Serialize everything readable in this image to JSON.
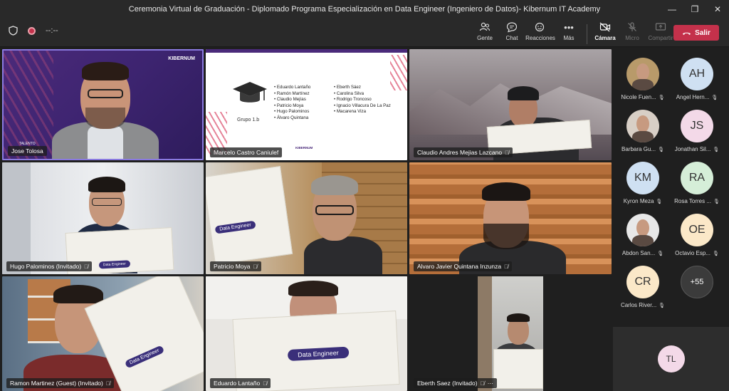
{
  "window": {
    "title": "Ceremonia Virtual de Graduación - Diplomado Programa Especialización en Data Engineer (Ingeniero de Datos)- Kibernum IT Academy",
    "minimize": "—",
    "maximize": "❐",
    "close": "✕"
  },
  "toolbar": {
    "timer": "--:--",
    "people_label": "Gente",
    "chat_label": "Chat",
    "reactions_label": "Reacciones",
    "more_label": "Más",
    "camera_label": "Cámara",
    "mic_label": "Micro",
    "share_label": "Compartir",
    "leave_label": "Salir"
  },
  "slide": {
    "brand": "KIBERNUM",
    "group": "Grupo 1.b",
    "col1": [
      "Eduardo Lantaño",
      "Ramón Martínez",
      "Claudio Mejías",
      "Patricio Moya",
      "Hugo Palominos",
      "Álvaro Quintana"
    ],
    "col2": [
      "Eberth Sáez",
      "Carolina Silva",
      "Rodrigo Troncoso",
      "Ignacio Villacura De La Paz",
      "Macarena Viza"
    ]
  },
  "brand_overlay": "KIBERNUM",
  "talent_text": "TALENTO",
  "cert_title": "Data Engineer",
  "tiles": [
    {
      "name": "Jose Tolosa"
    },
    {
      "name": "Marcelo Castro Caniulef"
    },
    {
      "name": "Claudio Andres Mejias Lazcano"
    },
    {
      "name": "Hugo Palominos (Invitado)"
    },
    {
      "name": "Patricio Moya"
    },
    {
      "name": "Alvaro Javier Quintana Inzunza"
    },
    {
      "name": "Ramon Martinez (Guest) (Invitado)"
    },
    {
      "name": "Eduardo Lantaño"
    },
    {
      "name": "Eberth Saez (Invitado)"
    }
  ],
  "more_dots": "···",
  "participants": [
    {
      "name": "Nicole Fuen...",
      "initials": "",
      "color": "#b89a6a"
    },
    {
      "name": "Angel Hern...",
      "initials": "AH",
      "color": "#cfe0f2"
    },
    {
      "name": "Barbara Gu...",
      "initials": "",
      "color": "#d8cfc6"
    },
    {
      "name": "Jonathan Sil...",
      "initials": "JS",
      "color": "#f3d9e8"
    },
    {
      "name": "Kyron Meza",
      "initials": "KM",
      "color": "#cfe0f2"
    },
    {
      "name": "Rosa Torres ...",
      "initials": "RA",
      "color": "#d5eed8"
    },
    {
      "name": "Abdon San...",
      "initials": "",
      "color": "#e8e8e8"
    },
    {
      "name": "Octavio Esp...",
      "initials": "OE",
      "color": "#fbe8c8"
    },
    {
      "name": "Carlos River...",
      "initials": "CR",
      "color": "#fbe8c8"
    }
  ],
  "overflow_count": "+55",
  "self_initials": "TL"
}
